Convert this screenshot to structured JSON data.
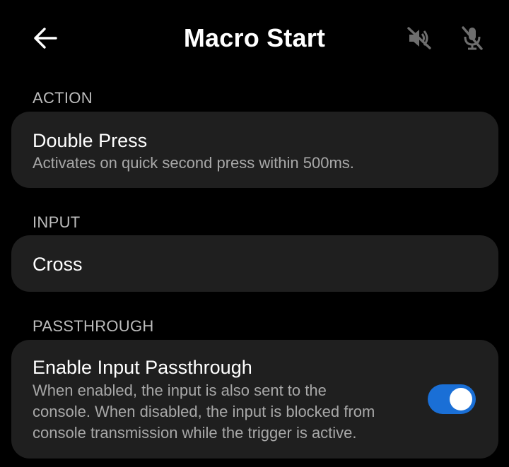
{
  "header": {
    "title": "Macro Start",
    "back_icon": "arrow-left-icon",
    "mute_icon": "speaker-muted-icon",
    "mic_icon": "mic-muted-icon"
  },
  "sections": {
    "action": {
      "label": "ACTION",
      "title": "Double Press",
      "subtitle": "Activates on quick second press within 500ms."
    },
    "input": {
      "label": "INPUT",
      "value": "Cross"
    },
    "passthrough": {
      "label": "PASSTHROUGH",
      "title": "Enable Input Passthrough",
      "description_line1": "When enabled, the input is also sent to the",
      "description_line2": "console. When disabled, the input is blocked from",
      "description_line3": "console transmission while the trigger is active.",
      "enabled": true
    }
  },
  "colors": {
    "background": "#000000",
    "card": "#1f1f1f",
    "accent": "#1a6fd6",
    "label": "#bdbdbd",
    "subtext": "#a8a8a8"
  }
}
